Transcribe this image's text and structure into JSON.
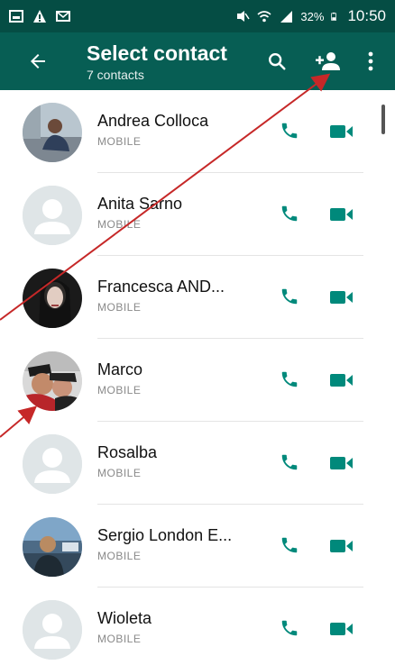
{
  "status_bar": {
    "battery_percent": "32%",
    "time": "10:50"
  },
  "toolbar": {
    "title": "Select contact",
    "subtitle": "7 contacts"
  },
  "contacts": [
    {
      "name": "Andrea Colloca",
      "type": "MOBILE",
      "avatar": "photo"
    },
    {
      "name": "Anita Sarno",
      "type": "MOBILE",
      "avatar": "default"
    },
    {
      "name": "Francesca AND...",
      "type": "MOBILE",
      "avatar": "photo"
    },
    {
      "name": "Marco",
      "type": "MOBILE",
      "avatar": "photo"
    },
    {
      "name": "Rosalba",
      "type": "MOBILE",
      "avatar": "default"
    },
    {
      "name": "Sergio London E...",
      "type": "MOBILE",
      "avatar": "photo"
    },
    {
      "name": "Wioleta",
      "type": "MOBILE",
      "avatar": "default"
    }
  ],
  "colors": {
    "status_bar": "#054d44",
    "toolbar": "#075e54",
    "accent_icon": "#00897b",
    "annotation_arrow": "#c62828"
  },
  "icons": {
    "back": "arrow-back-icon",
    "search": "search-icon",
    "add_contact": "person-add-icon",
    "more": "more-vert-icon",
    "call": "phone-icon",
    "video": "video-camera-icon"
  }
}
